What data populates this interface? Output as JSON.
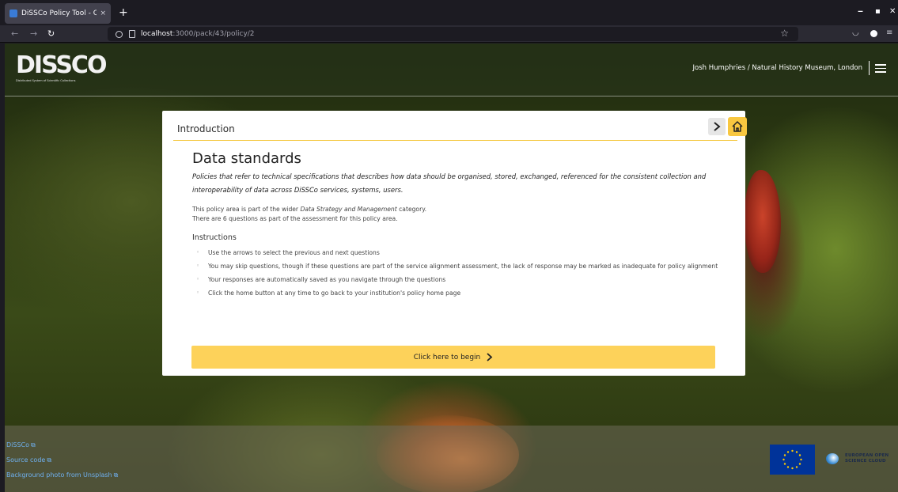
{
  "browser": {
    "tab_title": "DiSSCo Policy Tool - Que",
    "tab_close": "×",
    "new_tab": "+",
    "url_host": "localhost",
    "url_path": ":3000/pack/43/policy/2",
    "window_controls": [
      "‒",
      "▪",
      "✕"
    ]
  },
  "header": {
    "logo_text": "DISSCO",
    "logo_subtitle": "Distributed System of Scientific Collections",
    "user_info": "Josh Humphries / Natural History Museum, London"
  },
  "card": {
    "header_title": "Introduction",
    "next_icon": "chevron-right-icon",
    "home_icon": "home-icon",
    "policy_title": "Data standards",
    "policy_description": "Policies that refer to technical specifications that describes how data should be organised, stored, exchanged, referenced for the consistent collection and interoperability of data across DiSSCo services, systems, users.",
    "category_prefix": "This policy area is part of the wider ",
    "category_name": "Data Strategy and Management",
    "category_suffix": " category.",
    "question_count_text": "There are 6 questions as part of the assessment for this policy area.",
    "instructions_title": "Instructions",
    "instructions": [
      "Use the arrows to select the previous and next questions",
      "You may skip questions, though if these questions are part of the service alignment assessment, the lack of response may be marked as inadequate for policy alignment",
      "Your responses are automatically saved as you navigate through the questions",
      "Click the home button at any time to go back to your institution's policy home page"
    ],
    "begin_label": "Click here to begin"
  },
  "footer": {
    "links": [
      "DiSSCo",
      "Source code",
      "Background photo from Unsplash"
    ],
    "eosc_text_line1": "EUROPEAN OPEN",
    "eosc_text_line2": "SCIENCE CLOUD"
  },
  "colors": {
    "accent_yellow": "#fdd25a",
    "link_blue": "#6fb0f0"
  }
}
